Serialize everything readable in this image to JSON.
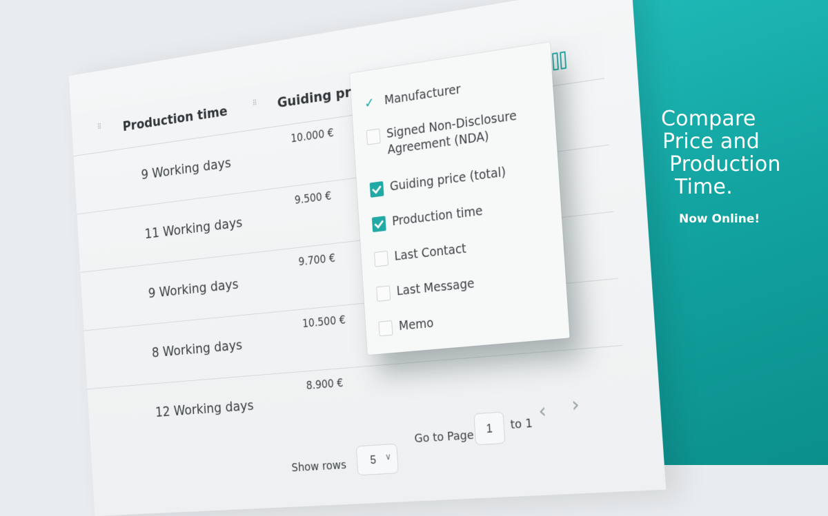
{
  "colors": {
    "accent": "#21a9a6",
    "brand_panel": "#12a3a0",
    "text": "#3a4044"
  },
  "table": {
    "headers": {
      "production_time": "Production time",
      "guiding_price": "Guiding price (total)"
    },
    "column_toggle_icon": "columns-icon",
    "rows": [
      {
        "production_time": "9 Working days",
        "price": "10.000 €"
      },
      {
        "production_time": "11 Working days",
        "price": "9.500 €"
      },
      {
        "production_time": "9 Working days",
        "price": "9.700 €"
      },
      {
        "production_time": "8 Working days",
        "price": "10.500 €"
      },
      {
        "production_time": "12 Working days",
        "price": "8.900 €"
      }
    ]
  },
  "column_menu": {
    "items": [
      {
        "label": "Manufacturer",
        "state": "checkmark"
      },
      {
        "label": "Signed Non-Disclosure Agreement (NDA)",
        "state": "unchecked"
      },
      {
        "label": "Guiding price (total)",
        "state": "checked"
      },
      {
        "label": "Production time",
        "state": "checked"
      },
      {
        "label": "Last Contact",
        "state": "unchecked"
      },
      {
        "label": "Last Message",
        "state": "unchecked"
      },
      {
        "label": "Memo",
        "state": "unchecked"
      }
    ]
  },
  "pagination": {
    "show_rows_label": "Show rows",
    "rows_value": "5",
    "go_to_page_label": "Go to Page",
    "page_value": "1",
    "to_label": "to 1",
    "prev_icon": "chevron-left-icon",
    "next_icon": "chevron-right-icon"
  },
  "promo": {
    "line1": "Compare",
    "line2": "Price and",
    "line3": "Production",
    "line4": "Time.",
    "sub": "Now Online!"
  }
}
